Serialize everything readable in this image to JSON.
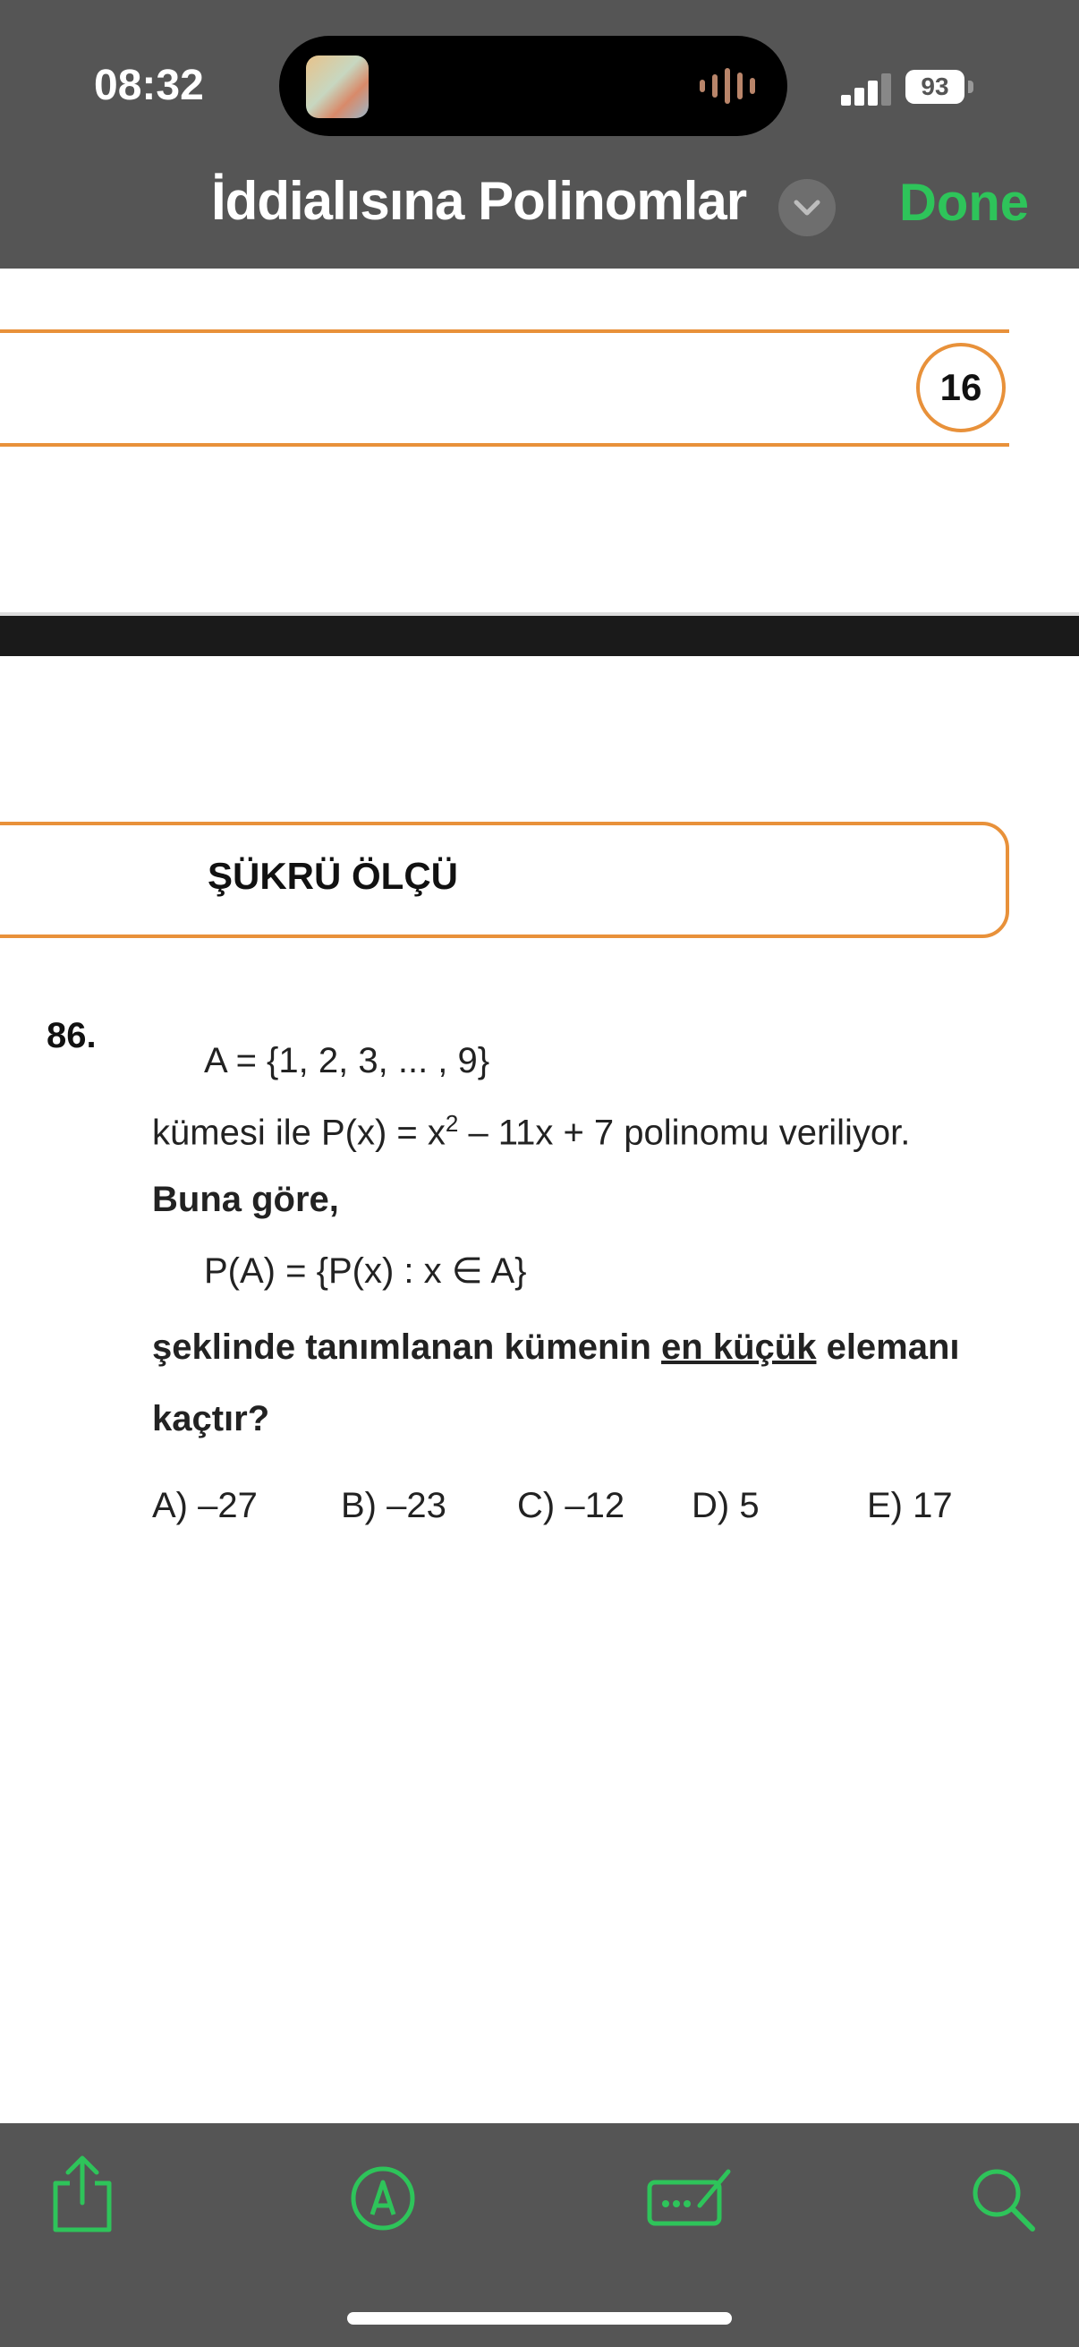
{
  "status_bar": {
    "time": "08:32",
    "battery": "93"
  },
  "nav": {
    "title": "İddialısına Polinomlar",
    "done_label": "Done"
  },
  "page": {
    "page_number": "16",
    "author": "ŞÜKRÜ ÖLÇÜ"
  },
  "question": {
    "number": "86.",
    "set_line": "A = {1, 2, 3, ... , 9}",
    "line2_a": "kümesi ile P(x) = x",
    "line2_sup": "2",
    "line2_b": " – 11x + 7 polinomu veriliyor.",
    "line3": "Buna göre,",
    "line4": "P(A) = {P(x) : x ∈ A}",
    "line5_a": "şeklinde tanımlanan kümenin ",
    "line5_u": "en küçük",
    "line5_b": " elemanı",
    "line6": "kaçtır?",
    "options": [
      "A) –27",
      "B) –23",
      "C) –12",
      "D) 5",
      "E) 17"
    ]
  },
  "toolbar": {
    "icons": [
      "share-icon",
      "markup-icon",
      "signature-icon",
      "search-icon"
    ]
  },
  "colors": {
    "accent_green": "#2ec45a",
    "orange_rule": "#e8913a",
    "bar_gray": "#555555"
  }
}
